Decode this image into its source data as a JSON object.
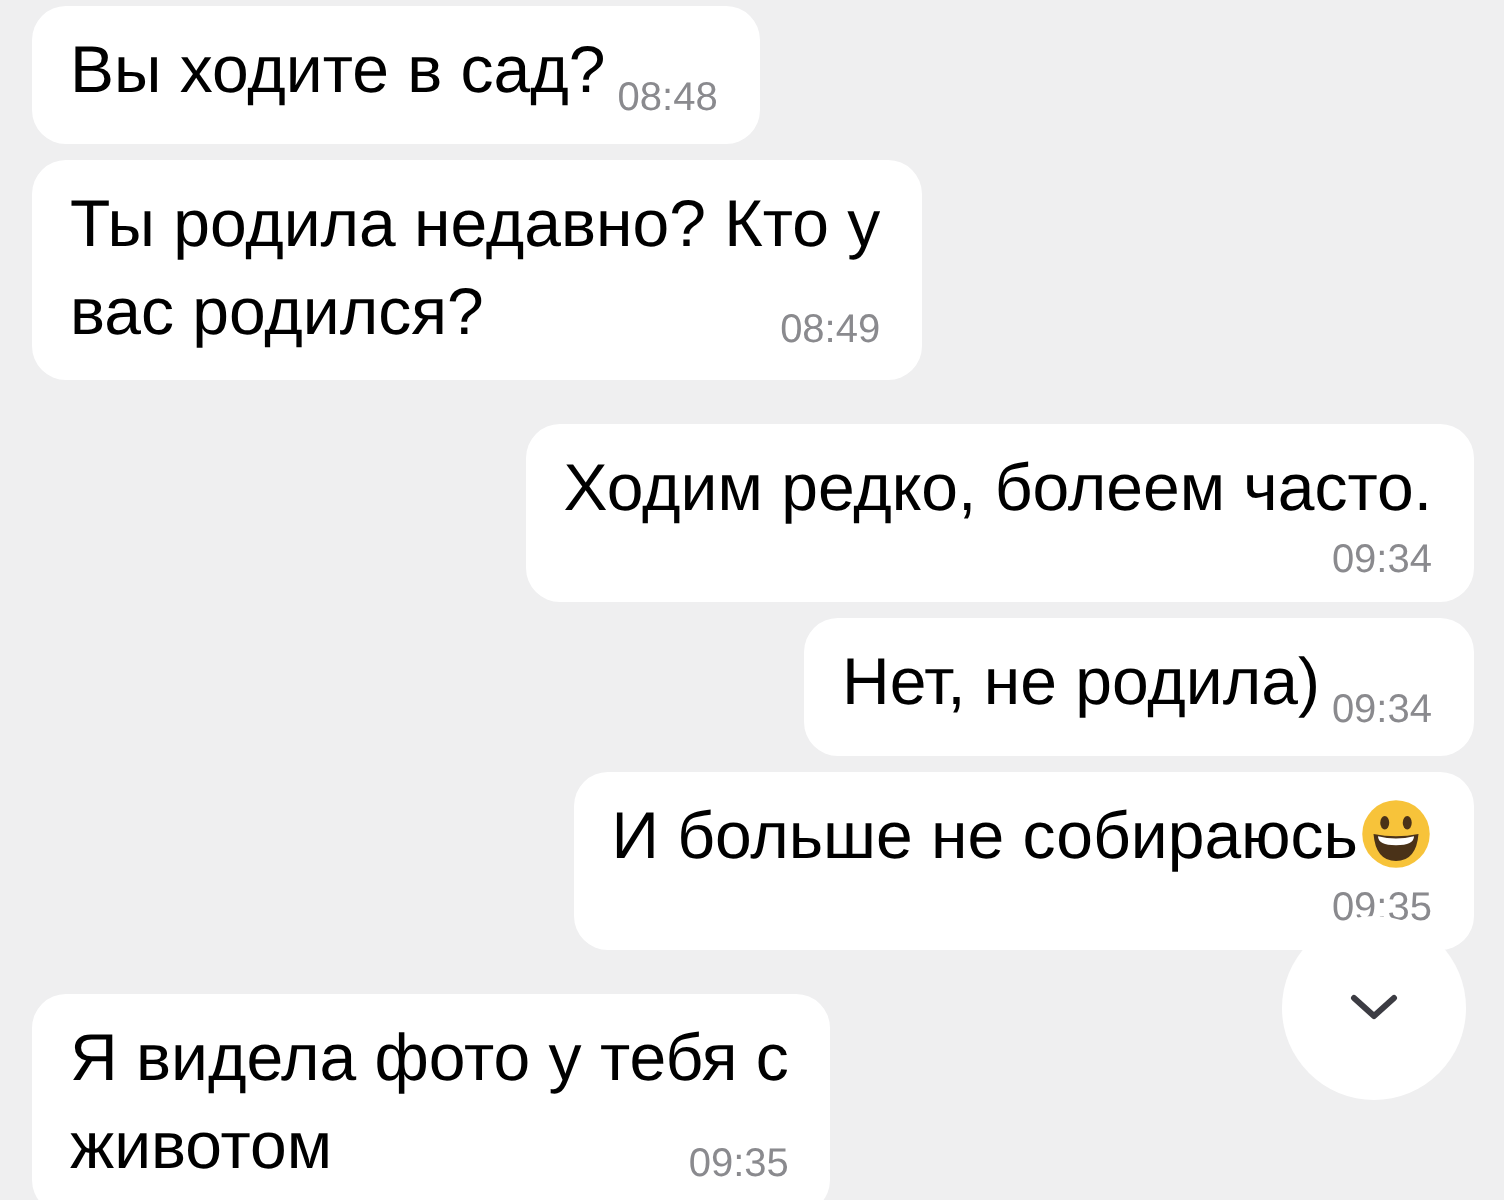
{
  "messages": [
    {
      "outgoing": false,
      "kind": "inline",
      "lines": [
        "Вы ходите в сад?"
      ],
      "time": "08:48"
    },
    {
      "outgoing": false,
      "kind": "wrapped",
      "lines": [
        "Ты родила недавно? Кто у",
        "вас родился?"
      ],
      "time": "08:49"
    },
    {
      "outgoing": true,
      "kind": "stacked",
      "lines": [
        "Ходим редко, болеем часто."
      ],
      "time": "09:34"
    },
    {
      "outgoing": true,
      "kind": "inline",
      "lines": [
        "Нет, не родила)"
      ],
      "time": "09:34"
    },
    {
      "outgoing": true,
      "kind": "stacked",
      "lines": [
        "И больше не собираюсь"
      ],
      "emoji": true,
      "time": "09:35"
    },
    {
      "outgoing": false,
      "kind": "wrapped",
      "lines": [
        "Я видела фото у тебя с",
        "животом"
      ],
      "time": "09:35"
    }
  ],
  "scroll_down_button": {
    "visible": true
  }
}
